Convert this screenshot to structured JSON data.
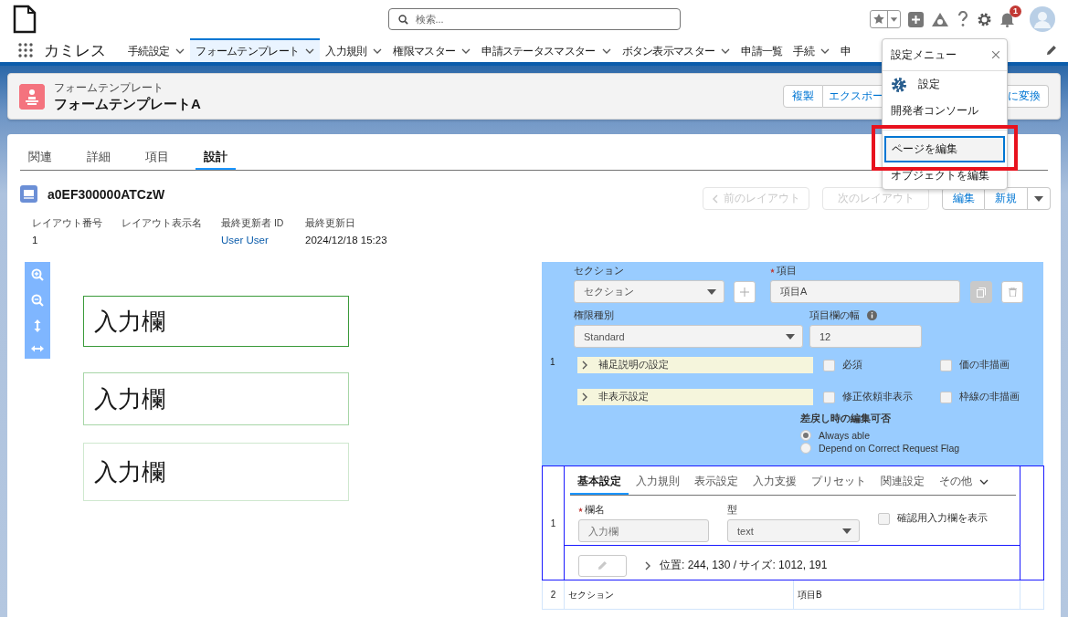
{
  "app": {
    "name": "カミレス"
  },
  "search": {
    "placeholder": "検索..."
  },
  "notifications": {
    "count": "1"
  },
  "nav": [
    {
      "label": "手続設定",
      "selected": false,
      "dropdown": true
    },
    {
      "label": "フォームテンプレート",
      "selected": true,
      "dropdown": true
    },
    {
      "label": "入力規則",
      "selected": false,
      "dropdown": true
    },
    {
      "label": "権限マスター",
      "selected": false,
      "dropdown": true
    },
    {
      "label": "申請ステータスマスター",
      "selected": false,
      "dropdown": true
    },
    {
      "label": "ボタン表示マスター",
      "selected": false,
      "dropdown": true
    },
    {
      "label": "申請一覧",
      "selected": false,
      "dropdown": false
    },
    {
      "label": "手続",
      "selected": false,
      "dropdown": true
    },
    {
      "label": "申",
      "selected": false,
      "dropdown": false
    }
  ],
  "record_header": {
    "object": "フォームテンプレート",
    "title": "フォームテンプレートA",
    "actions": [
      "複製",
      "エクスポー",
      "に変換"
    ]
  },
  "tabs": [
    {
      "label": "関連",
      "selected": false
    },
    {
      "label": "詳細",
      "selected": false
    },
    {
      "label": "項目",
      "selected": false
    },
    {
      "label": "設計",
      "selected": true
    }
  ],
  "layout": {
    "id": "a0EF300000ATCzW",
    "prev": "前のレイアウト",
    "next": "次のレイアウト",
    "actions": [
      "編集",
      "新規"
    ],
    "fields": [
      {
        "label": "レイアウト番号",
        "value": "1",
        "kind": "text"
      },
      {
        "label": "レイアウト表示名"
      },
      {
        "label": "最終更新者 ID",
        "value": "User User",
        "kind": "link"
      },
      {
        "label": "最終更新日",
        "value": "2024/12/18 15:23",
        "kind": "text"
      }
    ]
  },
  "canvas": {
    "boxes": [
      {
        "label": "入力欄",
        "selected": true
      },
      {
        "label": "入力欄",
        "selected": false
      },
      {
        "label": "入力欄",
        "selected": false
      }
    ]
  },
  "editor": {
    "row": "1",
    "section_label": "セクション",
    "section_value": "セクション",
    "item_label": "項目",
    "item_required": true,
    "item_value": "項目A",
    "permission_label": "権限種別",
    "permission_value": "Standard",
    "width_label": "項目欄の幅",
    "width_value": "12",
    "accordions": [
      "補足説明の設定",
      "非表示設定"
    ],
    "checkboxes": [
      {
        "label": "必須",
        "checked": false
      },
      {
        "label": "価の非描画",
        "checked": false
      },
      {
        "label": "修正依頼非表示",
        "checked": false
      },
      {
        "label": "枠線の非描画",
        "checked": false
      }
    ],
    "radio_title": "差戻し時の編集可否",
    "radios": [
      {
        "label": "Always able",
        "selected": true
      },
      {
        "label": "Depend on Correct Request Flag",
        "selected": false
      }
    ]
  },
  "detail": {
    "row": "1",
    "tabs": [
      {
        "label": "基本設定",
        "selected": true
      },
      {
        "label": "入力規則",
        "selected": false
      },
      {
        "label": "表示設定",
        "selected": false
      },
      {
        "label": "入力支援",
        "selected": false
      },
      {
        "label": "プリセット",
        "selected": false
      },
      {
        "label": "関連設定",
        "selected": false
      },
      {
        "label": "その他",
        "selected": false
      }
    ],
    "name_label": "欄名",
    "name_required": true,
    "name_placeholder": "入力欄",
    "type_label": "型",
    "type_value": "text",
    "confirm": {
      "label": "確認用入力欄を表示",
      "checked": false
    },
    "position": "位置: 244, 130 / サイズ: 1012, 191"
  },
  "rows": [
    {
      "number": "2",
      "section": "セクション",
      "item": "項目B"
    }
  ],
  "setup_menu": {
    "title": "設定メニュー",
    "items": [
      {
        "label": "設定",
        "kind": "gear",
        "selected": false
      },
      {
        "label": "開発者コンソール",
        "kind": "plain",
        "selected": false
      },
      {
        "label": "ページを編集",
        "kind": "plain",
        "selected": true
      },
      {
        "label": "オブジェクトを編集",
        "kind": "plain",
        "selected": false
      }
    ]
  }
}
